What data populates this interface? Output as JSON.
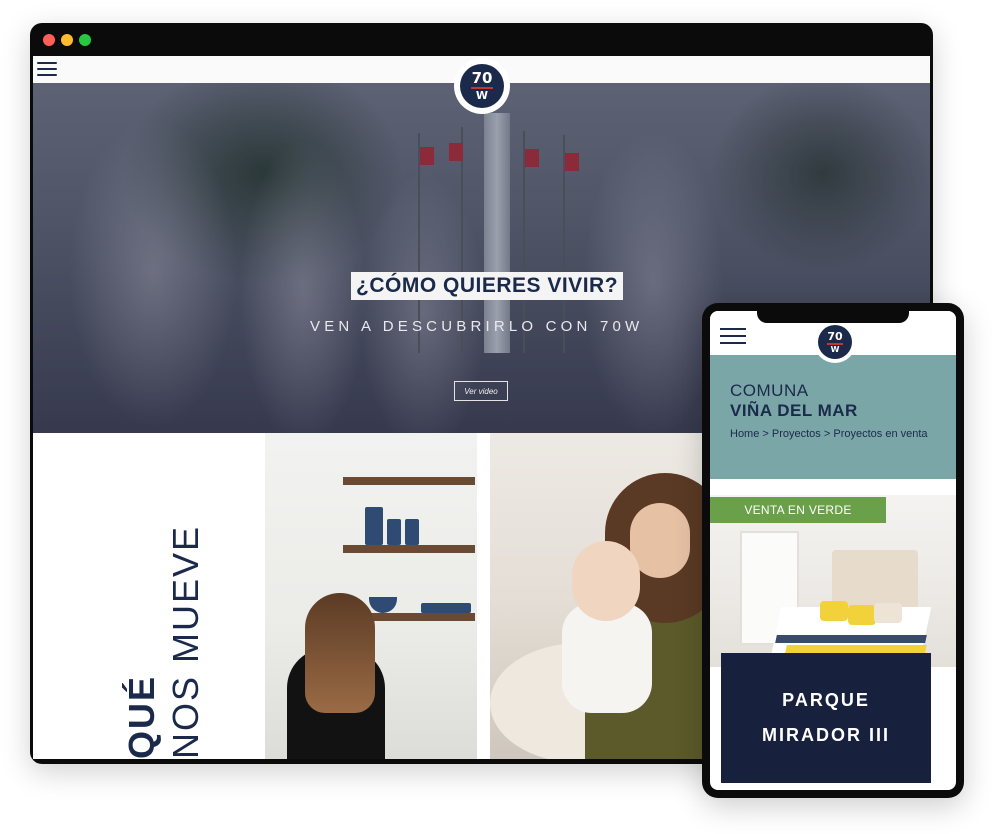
{
  "desktop": {
    "window_controls": {
      "close_color": "#ff5f57",
      "minimize_color": "#febc2e",
      "zoom_color": "#28c840"
    },
    "logo": {
      "line1": "70",
      "line2": "W"
    },
    "hero": {
      "title": "¿CÓMO QUIERES VIVIR?",
      "subtitle": "VEN A DESCUBRIRLO CON 70W",
      "video_button": "Ver video"
    },
    "section": {
      "word_bold": "QUÉ",
      "phrase": "NOS MUEVE"
    }
  },
  "phone": {
    "logo": {
      "line1": "70",
      "line2": "W"
    },
    "band": {
      "label": "COMUNA",
      "location": "VIÑA DEL MAR",
      "breadcrumb": {
        "home": "Home",
        "sep1": " > ",
        "projects": "Proyectos",
        "sep2": " > ",
        "current": "Proyectos en venta"
      }
    },
    "badge": "VENTA EN VERDE",
    "project": {
      "line1": "PARQUE",
      "line2": "MIRADOR III"
    },
    "colors": {
      "brand_navy": "#1b2a4a",
      "band_teal": "#7aa6a8",
      "badge_green": "#6aa04a"
    }
  }
}
